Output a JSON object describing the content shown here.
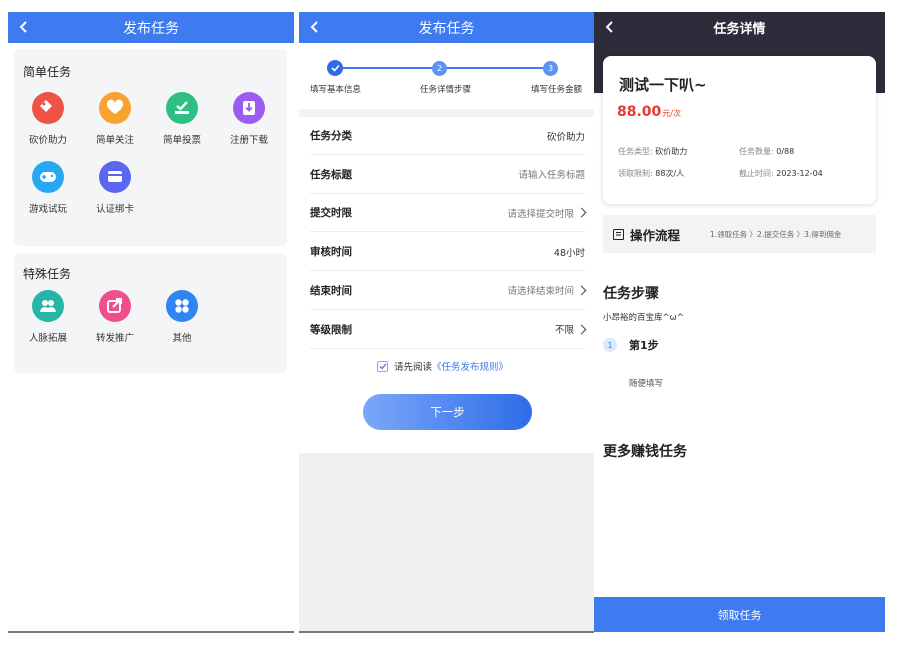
{
  "colors": {
    "primary": "#3e7bf0",
    "dark_header": "#2c2c3a",
    "price_red": "#e43a2f"
  },
  "screen1": {
    "nav": {
      "title": "发布任务",
      "back_icon": "chevron-left-icon"
    },
    "simple": {
      "title": "简单任务",
      "items": [
        {
          "label": "砍价助力",
          "icon": "price-tag-icon",
          "color": "#ef5346"
        },
        {
          "label": "简单关注",
          "icon": "heart-plus-icon",
          "color": "#f8a32f"
        },
        {
          "label": "简单投票",
          "icon": "vote-check-icon",
          "color": "#2fbf84"
        },
        {
          "label": "注册下载",
          "icon": "download-icon",
          "color": "#9a5cf0"
        },
        {
          "label": "游戏试玩",
          "icon": "gamepad-icon",
          "color": "#27a8f3"
        },
        {
          "label": "认证绑卡",
          "icon": "card-link-icon",
          "color": "#5a66f0"
        }
      ]
    },
    "special": {
      "title": "特殊任务",
      "items": [
        {
          "label": "人脉拓展",
          "icon": "people-icon",
          "color": "#27b5a8"
        },
        {
          "label": "转发推广",
          "icon": "share-icon",
          "color": "#f14f8c"
        },
        {
          "label": "其他",
          "icon": "grid-icon",
          "color": "#2f86f2"
        }
      ]
    }
  },
  "screen2": {
    "nav": {
      "title": "发布任务"
    },
    "steps": [
      {
        "num": "",
        "label": "填写基本信息",
        "done": true
      },
      {
        "num": "2",
        "label": "任务详情步骤",
        "done": false
      },
      {
        "num": "3",
        "label": "填写任务金额",
        "done": false
      }
    ],
    "form": [
      {
        "label": "任务分类",
        "value": "砍价助力",
        "placeholder": false,
        "arrow": false
      },
      {
        "label": "任务标题",
        "value": "请输入任务标题",
        "placeholder": true,
        "arrow": false
      },
      {
        "label": "提交时限",
        "value": "请选择提交时限",
        "placeholder": true,
        "arrow": true
      },
      {
        "label": "审核时间",
        "value": "48小时",
        "placeholder": false,
        "arrow": false
      },
      {
        "label": "结束时间",
        "value": "请选择结束时间",
        "placeholder": true,
        "arrow": true
      },
      {
        "label": "等级限制",
        "value": "不限",
        "placeholder": false,
        "arrow": true
      }
    ],
    "agree": {
      "prefix": "请先阅读",
      "link": "《任务发布规则》",
      "checked": true
    },
    "next_button": "下一步"
  },
  "screen3": {
    "nav": {
      "title": "任务详情"
    },
    "task": {
      "name": "测试一下叭~",
      "price": "88.00",
      "unit": "元/次",
      "type_label": "任务类型:",
      "type_value": "砍价助力",
      "count_label": "任务数量:",
      "count_value": "0/88",
      "limit_label": "领取限制:",
      "limit_value": "88次/人",
      "deadline_label": "截止时间:",
      "deadline_value": "2023-12-04"
    },
    "flow": {
      "title": "操作流程",
      "steps": "1.领取任务 〉2.提交任务 〉3.得到佣金"
    },
    "steps_title": "任务步骤",
    "author": "小昂裕的百宝库^ω^",
    "step1": {
      "num": "1",
      "title": "第1步",
      "desc": "随便填写"
    },
    "more_title": "更多赚钱任务",
    "claim_button": "领取任务"
  }
}
